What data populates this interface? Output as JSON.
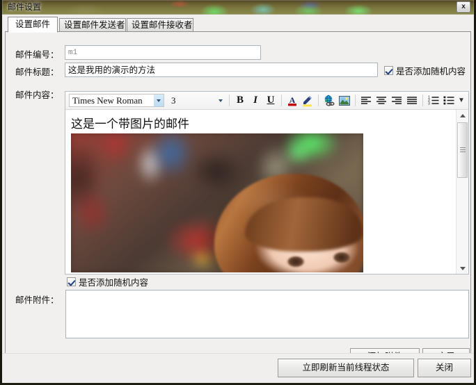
{
  "window": {
    "title": "邮件设置",
    "close_label": "x",
    "close_icon": "close-icon"
  },
  "tabs": [
    {
      "label": "设置邮件",
      "active": true
    },
    {
      "label": "设置邮件发送者",
      "active": false
    },
    {
      "label": "设置邮件接收者",
      "active": false
    }
  ],
  "form": {
    "mail_id_label": "邮件编号：",
    "mail_id_value": "m1",
    "mail_title_label": "邮件标题：",
    "mail_title_value": "这是我用的演示的方法",
    "mail_body_label": "邮件内容：",
    "mail_attach_label": "邮件附件：",
    "attachment_value": "",
    "random_checkbox_top_label": "是否添加随机内容",
    "random_checkbox_bottom_label": "是否添加随机内容"
  },
  "editor": {
    "font_family_value": "Times New Roman",
    "font_size_value": "3",
    "content_text": "这是一个带图片的邮件",
    "toolbar": {
      "bold": "B",
      "italic": "I",
      "underline": "U",
      "font_color_icon": "font-color-icon",
      "highlight_icon": "text-highlight-icon",
      "link_icon": "insert-link-icon",
      "image_icon": "insert-image-icon",
      "align_left_icon": "align-left-icon",
      "align_center_icon": "align-center-icon",
      "align_right_icon": "align-right-icon",
      "align_justify_icon": "align-justify-icon",
      "ordered_list_icon": "ordered-list-icon",
      "unordered_list_icon": "unordered-list-icon",
      "overflow_icon": "toolbar-overflow-icon"
    },
    "scrollbar": {
      "up_icon": "scroll-up-arrow-icon",
      "down_icon": "scroll-down-arrow-icon"
    }
  },
  "buttons": {
    "add_attachment": "添加附件",
    "apply": "应用",
    "refresh_thread": "立即刷新当前线程状态",
    "close": "关闭"
  },
  "colors": {
    "font_color_accent": "#c00000",
    "highlight_accent": "#ffe24d",
    "titlebar_glass": "#7d7a3f",
    "field_border": "#a9b4bd"
  }
}
